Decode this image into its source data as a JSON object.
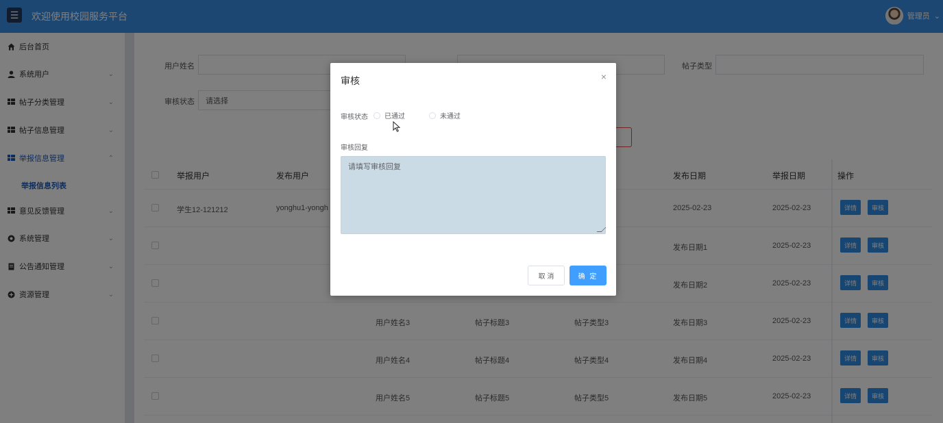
{
  "header": {
    "title": "欢迎使用校园服务平台",
    "menu_icon": "☰",
    "user_label": "管理员",
    "user_chevron": "⌄"
  },
  "sidebar": {
    "items": [
      {
        "label": "后台首页",
        "icon": "home-icon",
        "chevron": ""
      },
      {
        "label": "系统用户",
        "icon": "user-icon",
        "chevron": "⌄"
      },
      {
        "label": "帖子分类管理",
        "icon": "grid-icon",
        "chevron": "⌄"
      },
      {
        "label": "帖子信息管理",
        "icon": "grid-icon",
        "chevron": "⌄"
      },
      {
        "label": "举报信息管理",
        "icon": "grid-icon",
        "chevron": "⌃"
      },
      {
        "label": "意见反馈管理",
        "icon": "grid-icon",
        "chevron": "⌄"
      },
      {
        "label": "系统管理",
        "icon": "gear-icon",
        "chevron": "⌄"
      },
      {
        "label": "公告通知管理",
        "icon": "document-icon",
        "chevron": "⌄"
      },
      {
        "label": "资源管理",
        "icon": "plus-circle-icon",
        "chevron": "⌄"
      }
    ],
    "sub_item": "举报信息列表"
  },
  "filters": {
    "username_label": "用户姓名",
    "post_type_label": "帖子类型",
    "audit_status_label": "审核状态",
    "audit_status_placeholder": "请选择"
  },
  "table": {
    "headers": [
      "举报用户",
      "发布用户",
      "发布日期",
      "举报日期",
      "操作"
    ],
    "rows": [
      {
        "reporter": "学生12-121212",
        "publisher": "yonghu1-yongh",
        "c1": "",
        "c2": "",
        "c3": "",
        "pub_date": "2025-02-23",
        "report_date": "2025-02-23"
      },
      {
        "reporter": "",
        "publisher": "",
        "c1": "",
        "c2": "",
        "c3": "",
        "pub_date": "发布日期1",
        "report_date": "2025-02-23"
      },
      {
        "reporter": "",
        "publisher": "",
        "c1": "",
        "c2": "",
        "c3": "",
        "pub_date": "发布日期2",
        "report_date": "2025-02-23"
      },
      {
        "reporter": "",
        "publisher": "",
        "c1": "用户姓名3",
        "c2": "帖子标题3",
        "c3": "帖子类型3",
        "pub_date": "发布日期3",
        "report_date": "2025-02-23"
      },
      {
        "reporter": "",
        "publisher": "",
        "c1": "用户姓名4",
        "c2": "帖子标题4",
        "c3": "帖子类型4",
        "pub_date": "发布日期4",
        "report_date": "2025-02-23"
      },
      {
        "reporter": "",
        "publisher": "",
        "c1": "用户姓名5",
        "c2": "帖子标题5",
        "c3": "帖子类型5",
        "pub_date": "发布日期5",
        "report_date": "2025-02-23"
      }
    ],
    "detail_label": "详情",
    "audit_label": "审核"
  },
  "dialog": {
    "title": "审核",
    "close": "×",
    "status_label": "审核状态",
    "option_passed": "已通过",
    "option_rejected": "未通过",
    "reply_label": "审核回复",
    "reply_placeholder": "请填写审核回复",
    "cancel_label": "取 消",
    "ok_label": "确 定"
  },
  "colors": {
    "header": "#3a8ee6",
    "accent": "#409eff",
    "sidebar_active": "#1f5ab7"
  }
}
